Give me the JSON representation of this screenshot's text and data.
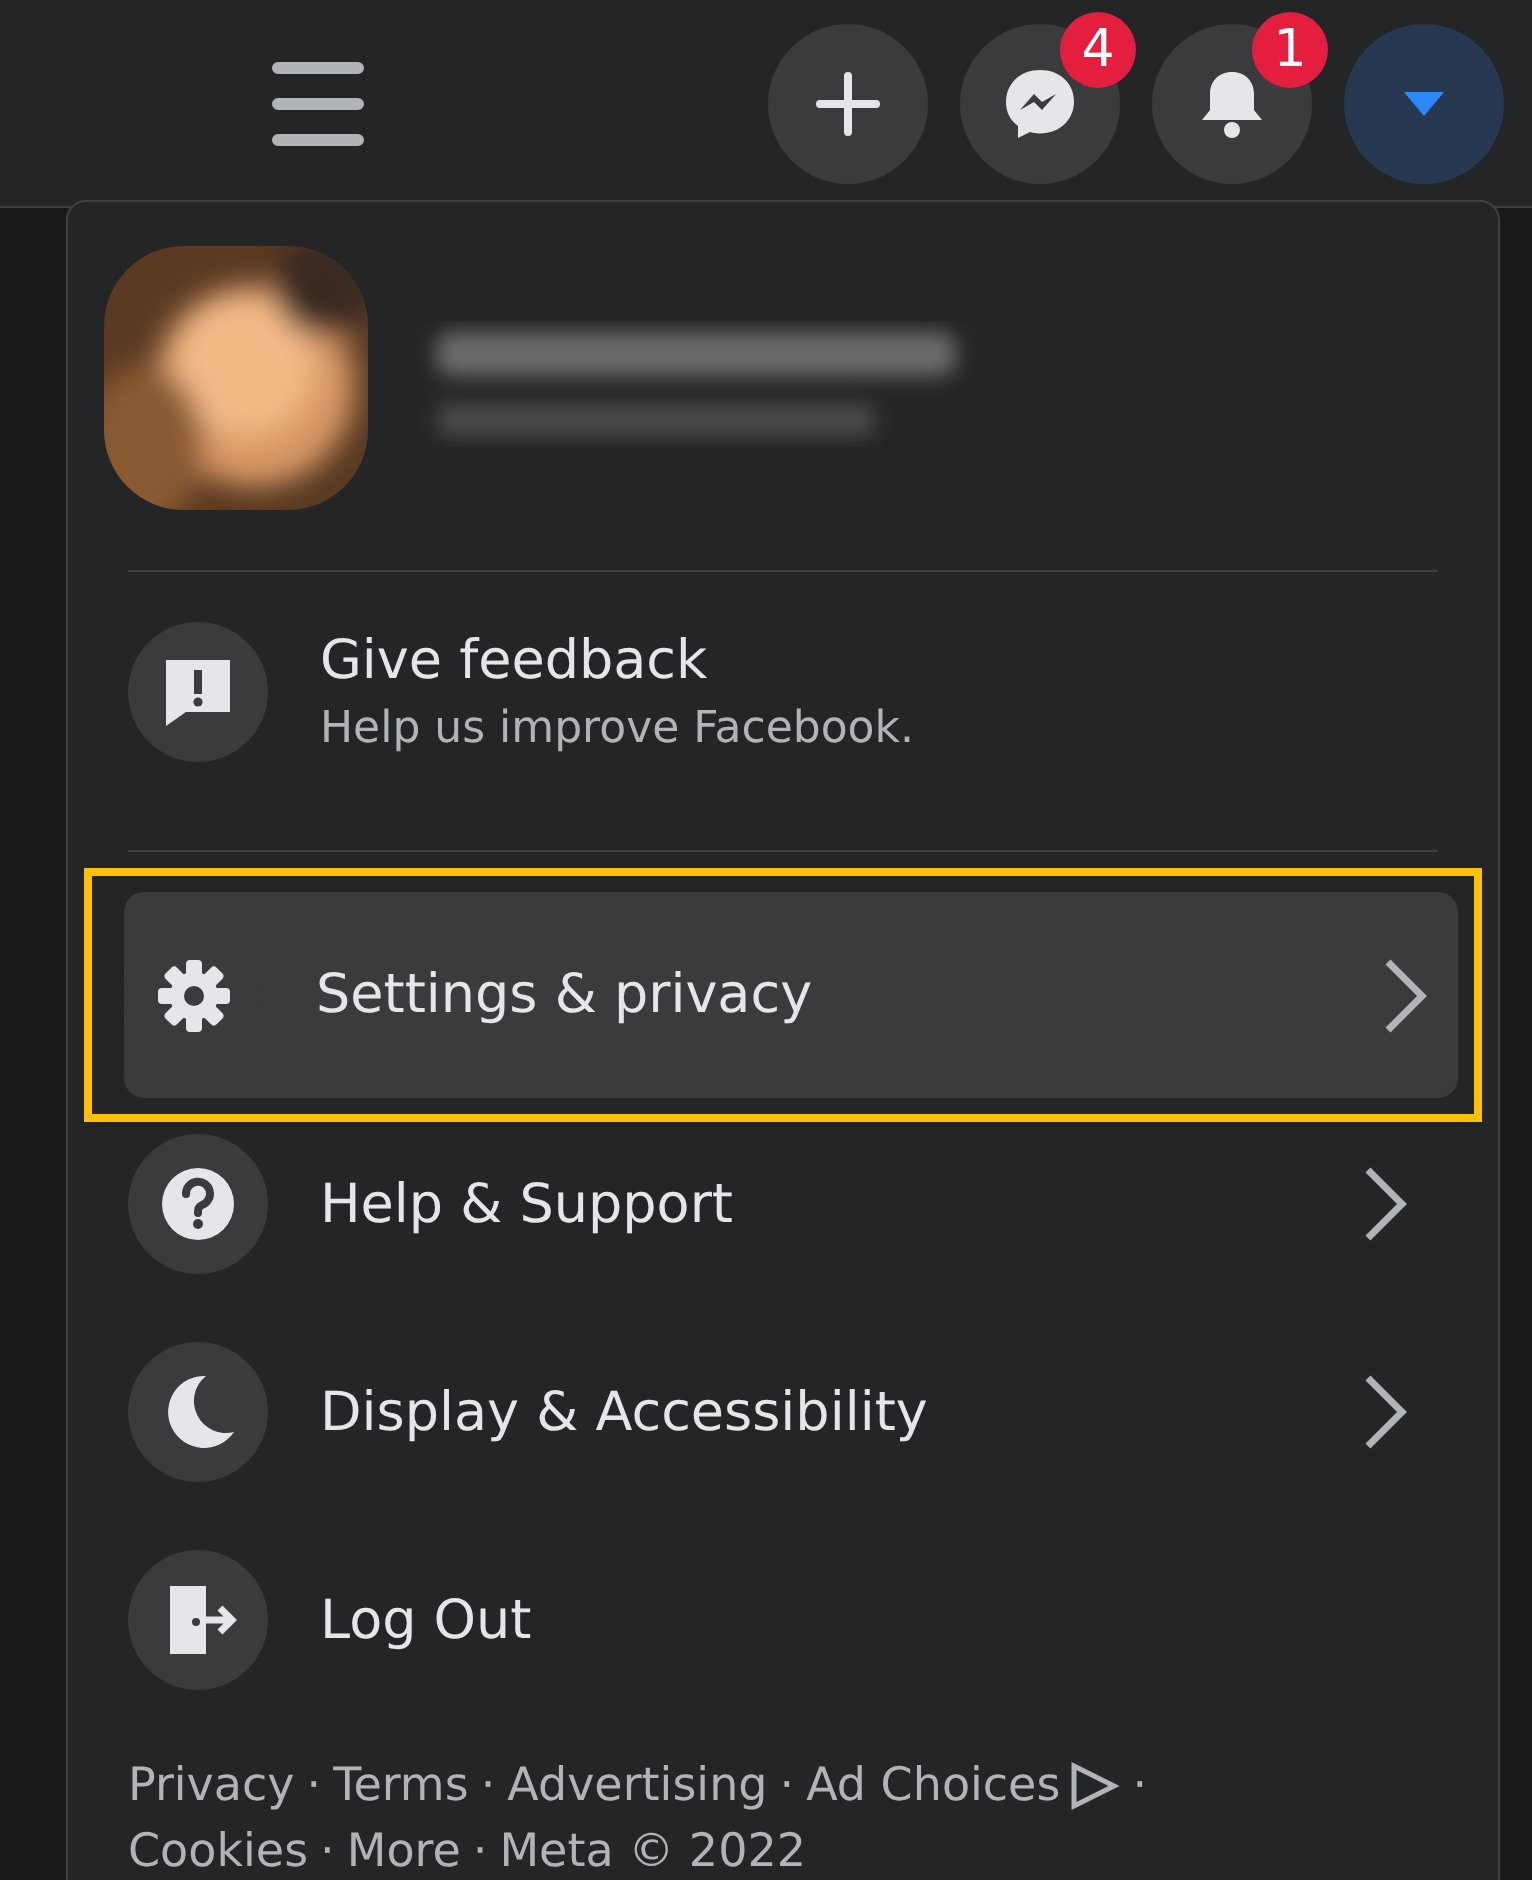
{
  "top_bar": {
    "buttons": [
      {
        "kind": "plus",
        "selected": false
      },
      {
        "kind": "messenger",
        "badge": "4",
        "selected": false
      },
      {
        "kind": "bell",
        "badge": "1",
        "selected": false
      },
      {
        "kind": "caret",
        "selected": true
      }
    ]
  },
  "menu": {
    "feedback": {
      "title": "Give feedback",
      "subtitle": "Help us improve Facebook."
    },
    "items": [
      {
        "kind": "settings",
        "label": "Settings & privacy",
        "chevron": true,
        "selected": true
      },
      {
        "kind": "help",
        "label": "Help & Support",
        "chevron": true,
        "selected": false
      },
      {
        "kind": "display",
        "label": "Display & Accessibility",
        "chevron": true,
        "selected": false
      },
      {
        "kind": "logout",
        "label": "Log Out",
        "chevron": false,
        "selected": false
      }
    ],
    "footer_lines": [
      [
        {
          "kind": "link",
          "text": "Privacy"
        },
        {
          "kind": "sep",
          "text": "·"
        },
        {
          "kind": "link",
          "text": "Terms"
        },
        {
          "kind": "sep",
          "text": "·"
        },
        {
          "kind": "link",
          "text": "Advertising"
        },
        {
          "kind": "sep",
          "text": "·"
        },
        {
          "kind": "link",
          "text": "Ad Choices",
          "ad_choices_icon": true
        },
        {
          "kind": "sep",
          "text": "·"
        }
      ],
      [
        {
          "kind": "link",
          "text": "Cookies"
        },
        {
          "kind": "sep",
          "text": "·"
        },
        {
          "kind": "link",
          "text": "More"
        },
        {
          "kind": "sep",
          "text": "·"
        },
        {
          "kind": "link",
          "text": "Meta © 2022"
        }
      ]
    ]
  }
}
